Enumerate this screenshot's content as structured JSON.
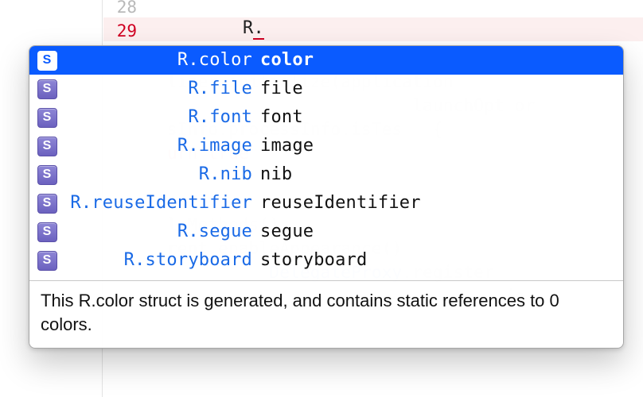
{
  "editor": {
    "line_numbers": [
      "28",
      "29"
    ],
    "error_line_index": 1,
    "code_fragment": "R.",
    "background_hint": "debug( application launching\nlizer.initialize(application\n                   launchOpt or\nsInfo.processInfo.isTes   {\nurn true\n\nleMethods()\nrent.enableAppearance()\nDelegateProxy.register\n                        (e"
  },
  "autocomplete": {
    "icon_glyph": "S",
    "selected_index": 0,
    "items": [
      {
        "qualified": "R.color",
        "name": "color"
      },
      {
        "qualified": "R.file",
        "name": "file"
      },
      {
        "qualified": "R.font",
        "name": "font"
      },
      {
        "qualified": "R.image",
        "name": "image"
      },
      {
        "qualified": "R.nib",
        "name": "nib"
      },
      {
        "qualified": "R.reuseIdentifier",
        "name": "reuseIdentifier"
      },
      {
        "qualified": "R.segue",
        "name": "segue"
      },
      {
        "qualified": "R.storyboard",
        "name": "storyboard"
      }
    ],
    "doc": "This R.color struct is generated, and contains static references to 0 colors."
  }
}
